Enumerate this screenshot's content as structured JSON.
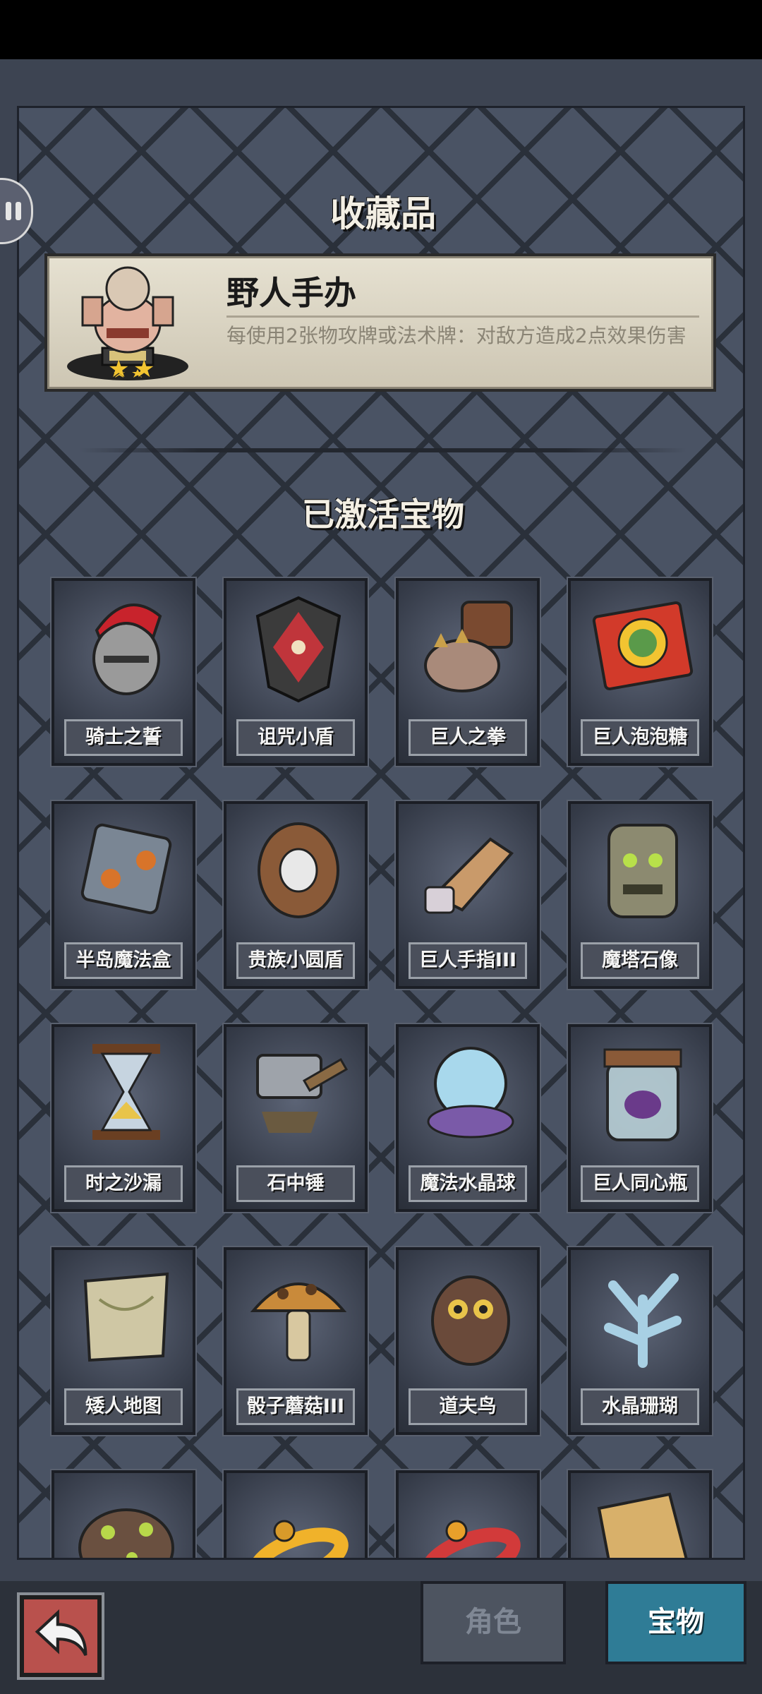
{
  "collection": {
    "title": "收藏品",
    "featured": {
      "name": "野人手办",
      "description": "每使用2张物攻牌或法术牌：对敌方造成2点效果伤害",
      "stars": 2
    }
  },
  "active_section": {
    "title": "已激活宝物",
    "items": [
      {
        "label": "骑士之誓",
        "icon": "knight-helmet-icon"
      },
      {
        "label": "诅咒小盾",
        "icon": "cursed-shield-icon"
      },
      {
        "label": "巨人之拳",
        "icon": "giant-fist-icon"
      },
      {
        "label": "巨人泡泡糖",
        "icon": "bubblegum-icon"
      },
      {
        "label": "半岛魔法盒",
        "icon": "magic-box-icon"
      },
      {
        "label": "贵族小圆盾",
        "icon": "round-shield-icon"
      },
      {
        "label": "巨人手指III",
        "icon": "giant-finger-icon"
      },
      {
        "label": "魔塔石像",
        "icon": "stone-statue-icon"
      },
      {
        "label": "时之沙漏",
        "icon": "hourglass-icon"
      },
      {
        "label": "石中锤",
        "icon": "stone-hammer-icon"
      },
      {
        "label": "魔法水晶球",
        "icon": "crystal-ball-icon"
      },
      {
        "label": "巨人同心瓶",
        "icon": "jar-icon"
      },
      {
        "label": "矮人地图",
        "icon": "map-scroll-icon"
      },
      {
        "label": "骰子蘑菇III",
        "icon": "dice-mushroom-icon"
      },
      {
        "label": "道夫鸟",
        "icon": "owl-icon"
      },
      {
        "label": "水晶珊瑚",
        "icon": "crystal-coral-icon"
      },
      {
        "label": "",
        "icon": "toad-icon"
      },
      {
        "label": "",
        "icon": "yellow-ring-icon"
      },
      {
        "label": "",
        "icon": "red-ring-icon"
      },
      {
        "label": "",
        "icon": "parchment-icon"
      }
    ]
  },
  "tabs": {
    "role": "角色",
    "treasure": "宝物"
  },
  "colors": {
    "active_tab": "#2f7c96",
    "back_button": "#b9514d"
  }
}
